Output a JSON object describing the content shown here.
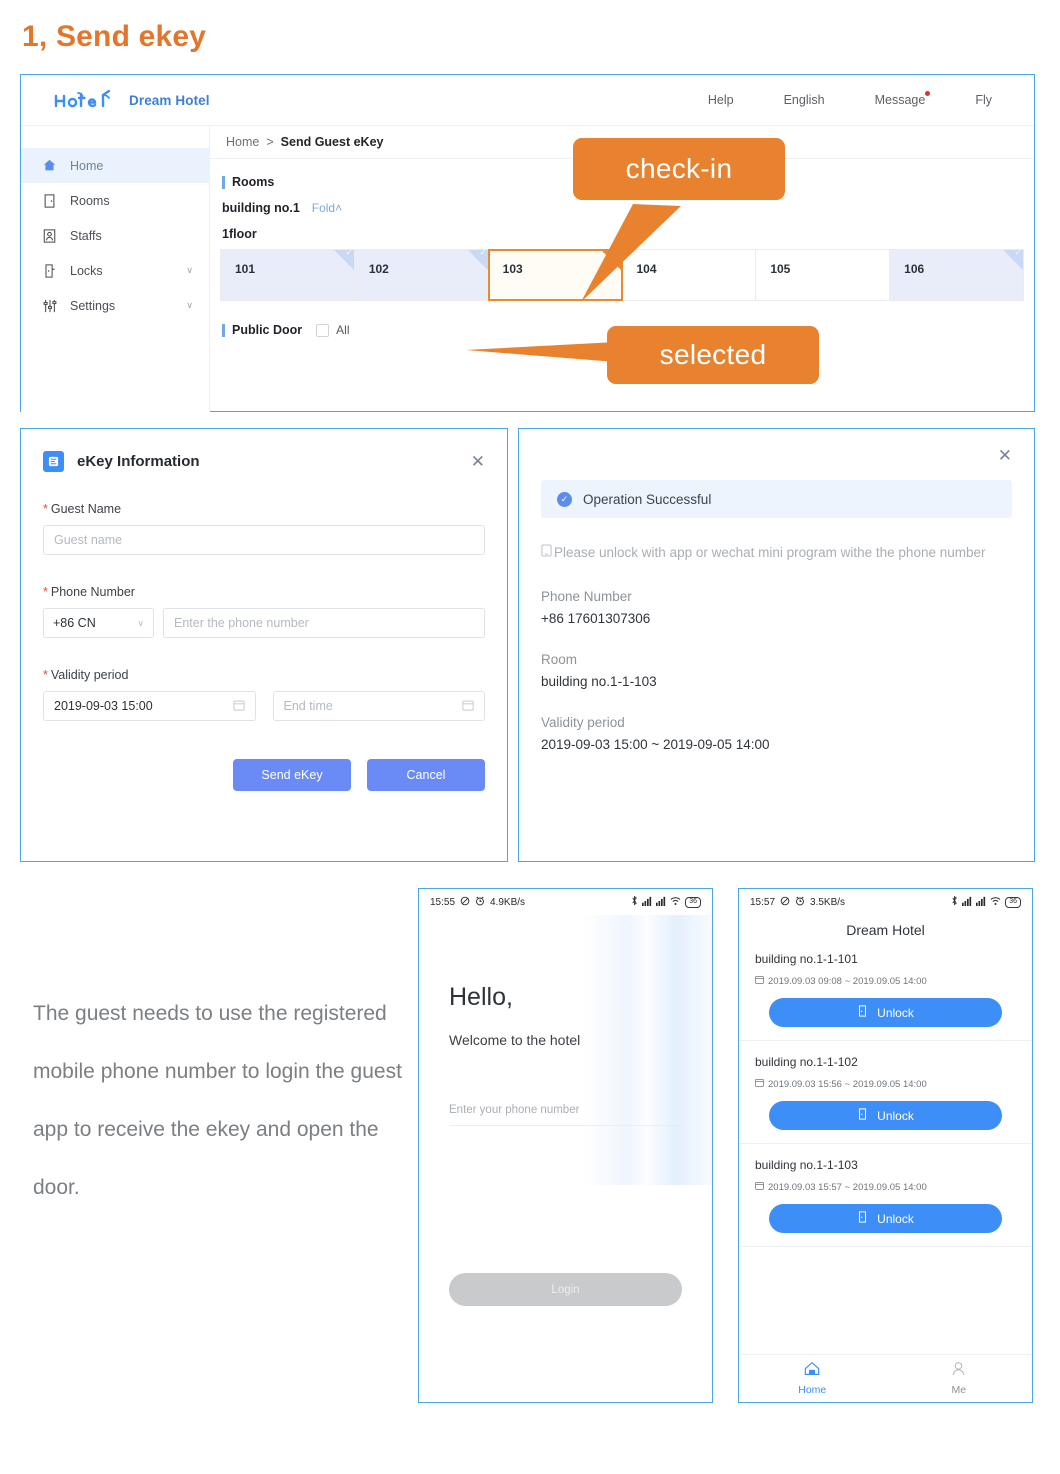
{
  "section": {
    "title": "1, Send ekey"
  },
  "admin": {
    "brand": {
      "logo_icon": "hotel-wordmark-logo",
      "name": "Dream Hotel"
    },
    "top_nav": [
      {
        "label": "Help",
        "badge": false
      },
      {
        "label": "English",
        "badge": false
      },
      {
        "label": "Message",
        "badge": true
      },
      {
        "label": "Fly",
        "badge": false
      }
    ],
    "sidebar": [
      {
        "label": "Home",
        "icon": "home-icon",
        "active": true,
        "chevron": ""
      },
      {
        "label": "Rooms",
        "icon": "door-icon",
        "active": false,
        "chevron": ""
      },
      {
        "label": "Staffs",
        "icon": "staff-icon",
        "active": false,
        "chevron": ""
      },
      {
        "label": "Locks",
        "icon": "lock-icon",
        "active": false,
        "chevron": "∨"
      },
      {
        "label": "Settings",
        "icon": "sliders-icon",
        "active": false,
        "chevron": "∨"
      }
    ],
    "breadcrumb": {
      "home": "Home",
      "sep": ">",
      "current": "Send Guest eKey"
    },
    "rooms_block": {
      "title": "Rooms",
      "building": "building no.1",
      "fold": "Fold",
      "fold_caret": "˄",
      "floor": "1floor",
      "rooms": [
        {
          "name": "101",
          "state": "occupied"
        },
        {
          "name": "102",
          "state": "occupied"
        },
        {
          "name": "103",
          "state": "selected"
        },
        {
          "name": "104",
          "state": "available"
        },
        {
          "name": "105",
          "state": "available"
        },
        {
          "name": "106",
          "state": "occupied"
        }
      ]
    },
    "public_door": {
      "label": "Public Door",
      "all_label": "All",
      "checked": false
    }
  },
  "callouts": {
    "checkin": "check-in",
    "selected": "selected",
    "color": "#E8822E"
  },
  "ekey_dialog": {
    "icon": "form-icon",
    "title": "eKey Information",
    "close_icon": "close-icon",
    "guest_name": {
      "label": "Guest Name",
      "required": "*",
      "placeholder": "Guest name",
      "value": ""
    },
    "phone": {
      "label": "Phone Number",
      "required": "*",
      "country_code": "+86 CN",
      "caret": "∨",
      "placeholder": "Enter the phone number",
      "value": ""
    },
    "validity": {
      "label": "Validity period",
      "required": "*",
      "start_value": "2019-09-03 15:00",
      "end_placeholder": "End time",
      "calendar_icon": "calendar-icon"
    },
    "buttons": {
      "submit": "Send eKey",
      "cancel": "Cancel",
      "color": "#6A8BF5"
    }
  },
  "success_panel": {
    "close_icon": "close-icon",
    "status": {
      "icon": "check-circle-icon",
      "text": "Operation Successful"
    },
    "note_icon": "phone-icon",
    "note": "Please unlock with app or wechat mini program withe the phone number",
    "fields": [
      {
        "label": "Phone Number",
        "value": "+86 17601307306"
      },
      {
        "label": "Room",
        "value": "building no.1-1-103"
      },
      {
        "label": "Validity period",
        "value": "2019-09-03 15:00  ~  2019-09-05 14:00"
      }
    ]
  },
  "paragraph": "The guest needs to use the registered mobile phone number to login the guest app to receive the ekey and open the door.",
  "phone_login": {
    "status_bar": {
      "time": "15:55",
      "icons_left": [
        "mute-icon",
        "alarm-icon"
      ],
      "net_speed": "4.9KB/s",
      "icons_right": [
        "bluetooth-icon",
        "signal-1-icon",
        "signal-2-icon",
        "wifi-icon"
      ],
      "battery": "36"
    },
    "hello": "Hello,",
    "welcome": "Welcome to the hotel",
    "phone_placeholder": "Enter your phone number",
    "login_button": "Login"
  },
  "phone_keys": {
    "status_bar": {
      "time": "15:57",
      "icons_left": [
        "mute-icon",
        "alarm-icon"
      ],
      "net_speed": "3.5KB/s",
      "icons_right": [
        "bluetooth-icon",
        "signal-1-icon",
        "signal-2-icon",
        "wifi-icon"
      ],
      "battery": "36"
    },
    "title": "Dream Hotel",
    "calendar_icon": "calendar-icon",
    "lock_icon": "lock-icon",
    "items": [
      {
        "room": "building no.1-1-101",
        "period": "2019.09.03 09:08 ~ 2019.09.05 14:00",
        "action": "Unlock"
      },
      {
        "room": "building no.1-1-102",
        "period": "2019.09.03 15:56 ~ 2019.09.05 14:00",
        "action": "Unlock"
      },
      {
        "room": "building no.1-1-103",
        "period": "2019.09.03 15:57 ~ 2019.09.05 14:00",
        "action": "Unlock"
      }
    ],
    "tabs": [
      {
        "label": "Home",
        "icon": "home-icon",
        "active": true
      },
      {
        "label": "Me",
        "icon": "person-icon",
        "active": false
      }
    ]
  }
}
